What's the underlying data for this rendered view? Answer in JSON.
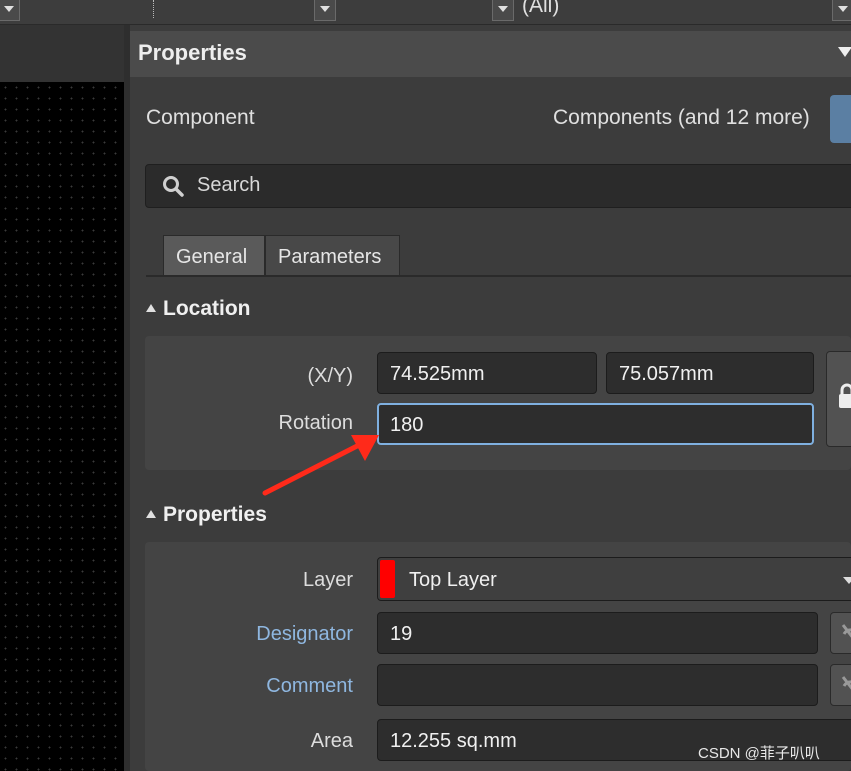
{
  "toolbar": {
    "filter_value": "(All)"
  },
  "panel": {
    "title": "Properties",
    "component_label": "Component",
    "filter_label": "Components (and 12 more)",
    "search_placeholder": "Search",
    "tabs": [
      {
        "label": "General"
      },
      {
        "label": "Parameters"
      }
    ]
  },
  "location": {
    "section_title": "Location",
    "xy_label": "(X/Y)",
    "x_value": "74.525mm",
    "y_value": "75.057mm",
    "rotation_label": "Rotation",
    "rotation_value": "180"
  },
  "properties": {
    "section_title": "Properties",
    "layer_label": "Layer",
    "layer_value": "Top Layer",
    "layer_color": "#ff0000",
    "designator_label": "Designator",
    "designator_value": "19",
    "comment_label": "Comment",
    "comment_value": "",
    "area_label": "Area",
    "area_value": "12.255 sq.mm"
  },
  "annotation": {
    "arrow_color": "#ff2a1a"
  },
  "watermark": "CSDN @菲子叭叭",
  "colors": {
    "panel_bg": "#3c3c3c",
    "header_bg": "#4b4b4b",
    "accent": "#7fb0e0",
    "link_label": "#8fb7e0"
  }
}
